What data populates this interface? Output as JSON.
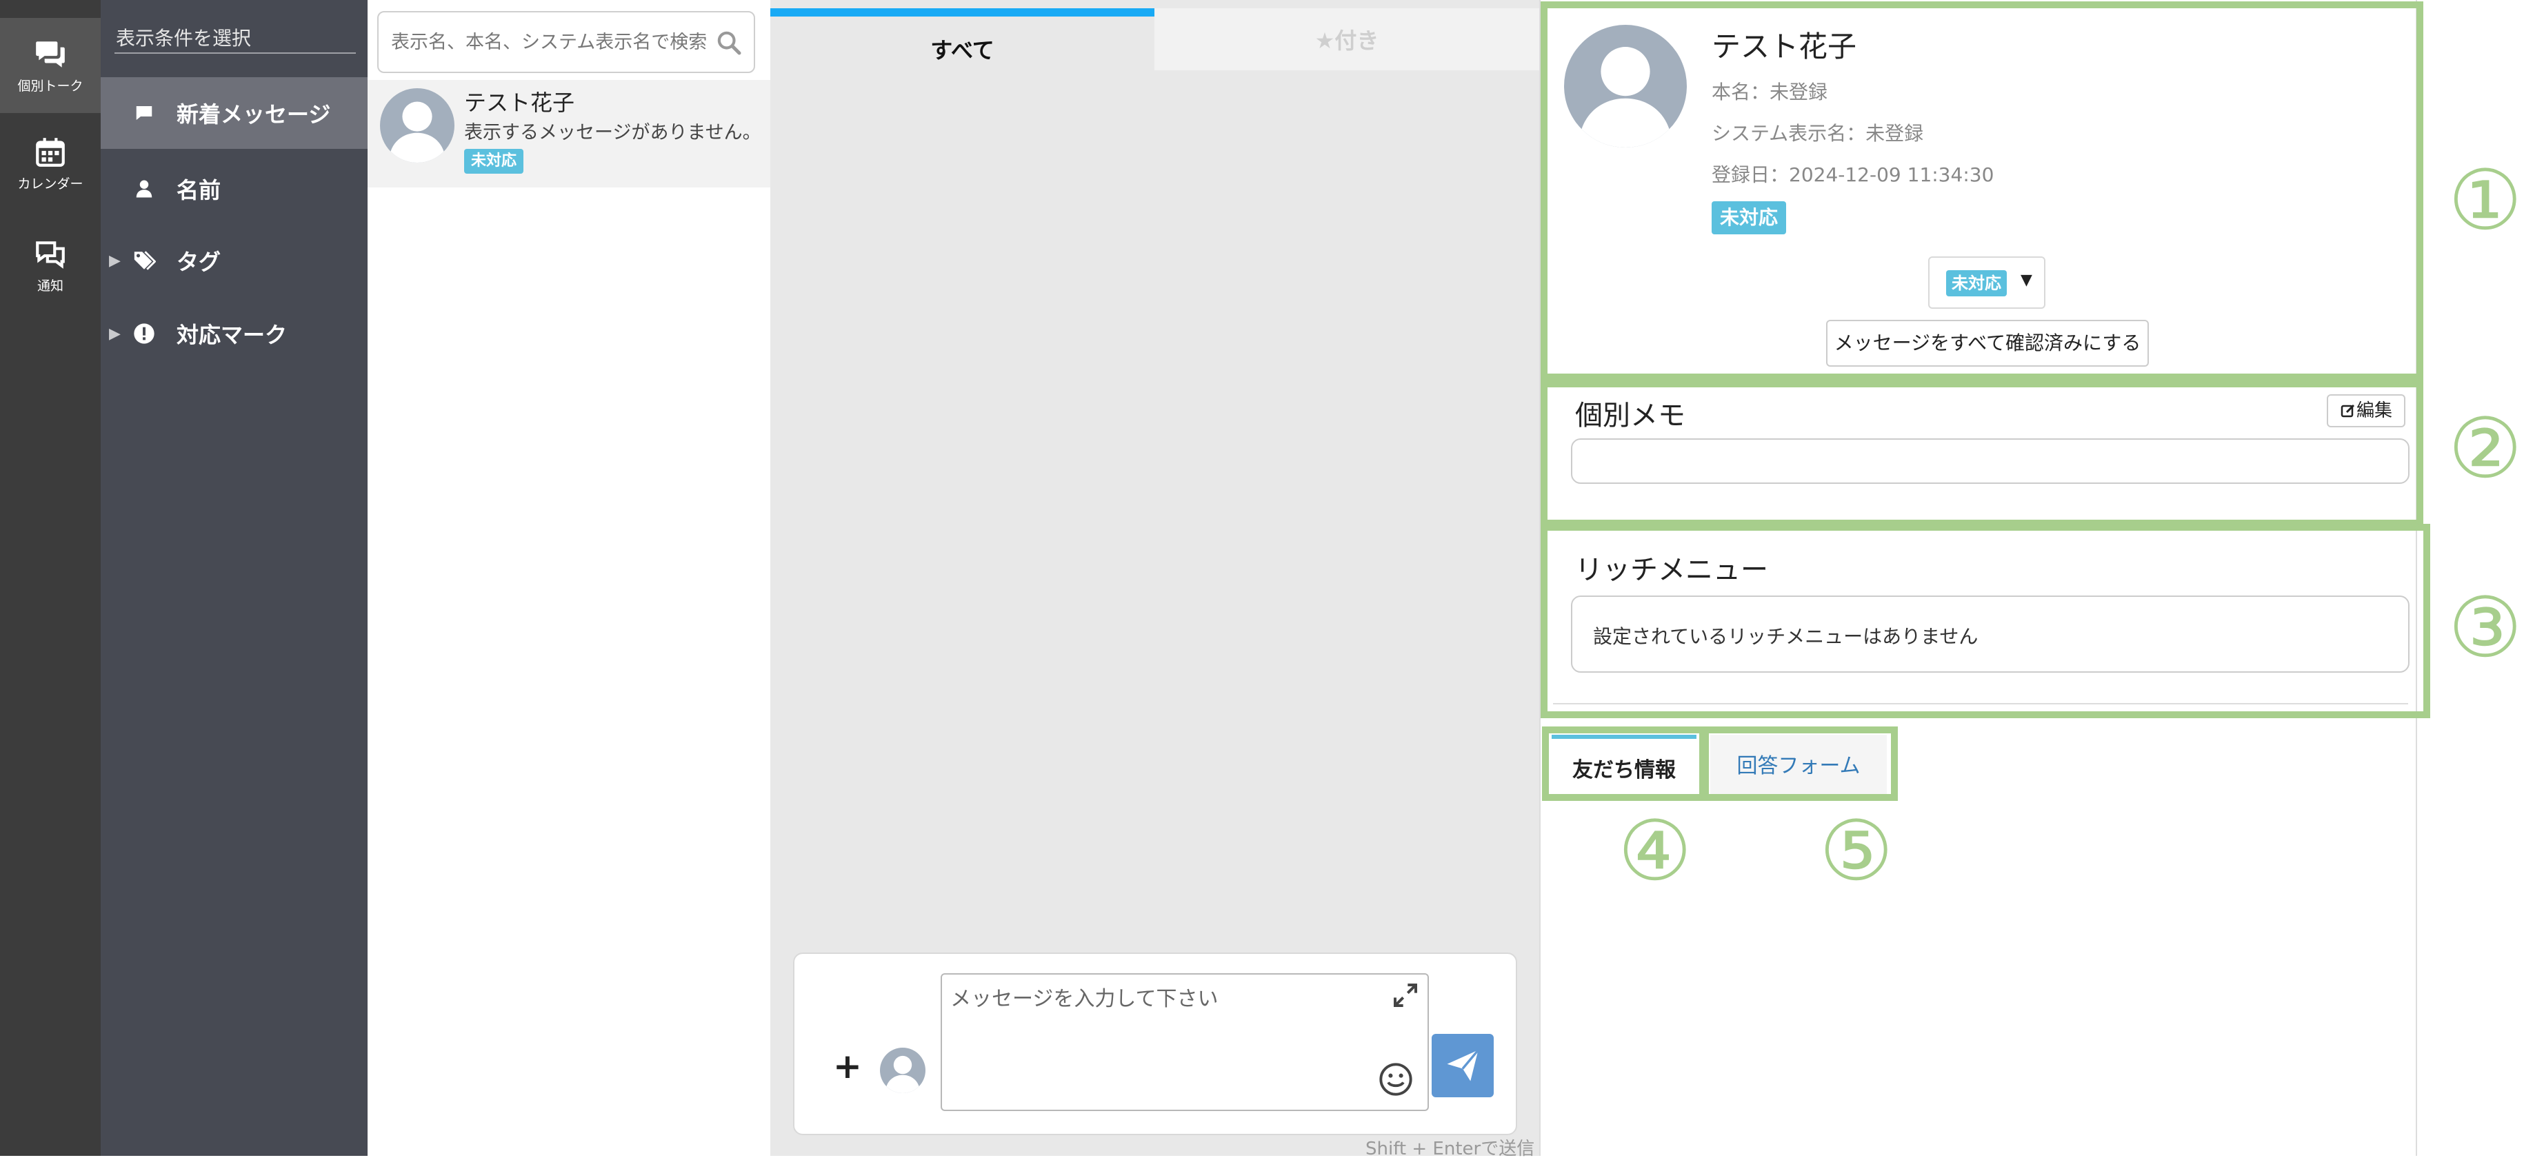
{
  "rail": {
    "items": [
      {
        "label": "個別トーク",
        "icon": "chat-bubbles-icon",
        "active": true
      },
      {
        "label": "カレンダー",
        "icon": "calendar-icon",
        "active": false
      },
      {
        "label": "通知",
        "icon": "notification-chat-icon",
        "active": false
      }
    ]
  },
  "filter": {
    "title": "表示条件を選択",
    "items": [
      {
        "label": "新着メッセージ",
        "icon": "message-icon",
        "active": true
      },
      {
        "label": "名前",
        "icon": "person-icon",
        "active": false
      },
      {
        "label": "タグ",
        "icon": "tags-icon",
        "expandable": true
      },
      {
        "label": "対応マーク",
        "icon": "exclamation-circle-icon",
        "expandable": true
      }
    ]
  },
  "search": {
    "placeholder": "表示名、本名、システム表示名で検索"
  },
  "contacts": [
    {
      "name": "テスト花子",
      "preview": "表示するメッセージがありません。",
      "badge": "未対応"
    }
  ],
  "chat": {
    "tabs": [
      {
        "label": "すべて",
        "active": true
      },
      {
        "label": "★付き",
        "active": false
      }
    ],
    "composer": {
      "placeholder": "メッセージを入力して下さい",
      "plus": "+",
      "hint": "Shift + Enterで送信"
    }
  },
  "profile": {
    "name": "テスト花子",
    "real_name": "本名：未登録",
    "system_name": "システム表示名：未登録",
    "registered": "登録日：2024-12-09 11:34:30",
    "badge": "未対応",
    "status_dropdown": "未対応",
    "confirm_button": "メッセージをすべて確認済みにする"
  },
  "memo": {
    "title": "個別メモ",
    "edit_label": "編集"
  },
  "rich_menu": {
    "title": "リッチメニュー",
    "empty_text": "設定されているリッチメニューはありません"
  },
  "info_tabs": [
    {
      "label": "友だち情報",
      "active": true
    },
    {
      "label": "回答フォーム",
      "active": false
    }
  ],
  "callouts": [
    "①",
    "②",
    "③",
    "④",
    "⑤"
  ],
  "colors": {
    "rail_bg": "#3c3c3c",
    "filter_bg": "#474a53",
    "badge_bg": "#5bc0de",
    "tab_accent": "#19aaf5",
    "send_button": "#5f97d3",
    "highlight_green": "#a7ce8c",
    "link_blue": "#337ab7"
  }
}
